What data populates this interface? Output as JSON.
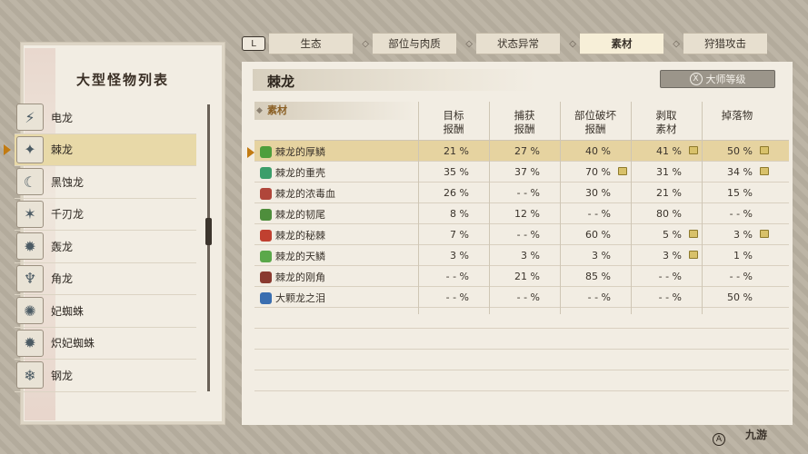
{
  "left": {
    "title": "大型怪物列表",
    "monsters": [
      {
        "name": "电龙",
        "icon": "zinogre-icon"
      },
      {
        "name": "棘龙",
        "icon": "espinas-icon",
        "selected": true
      },
      {
        "name": "黑蚀龙",
        "icon": "gore-magala-icon"
      },
      {
        "name": "千刃龙",
        "icon": "seregios-icon"
      },
      {
        "name": "轰龙",
        "icon": "tigrex-icon"
      },
      {
        "name": "角龙",
        "icon": "diablos-icon"
      },
      {
        "name": "妃蜘蛛",
        "icon": "rakna-kadaki-icon"
      },
      {
        "name": "炽妃蜘蛛",
        "icon": "pyre-rakna-kadaki-icon"
      },
      {
        "name": "钢龙",
        "icon": "kushala-daora-icon"
      }
    ]
  },
  "tabs": {
    "left_key": "L",
    "items": [
      "生态",
      "部位与肉质",
      "状态异常",
      "素材",
      "狩猎攻击"
    ],
    "active": "素材"
  },
  "header": {
    "monster_name": "棘龙",
    "master_rank_button": "大师等级",
    "x_key": "X"
  },
  "table": {
    "material_header": "素材",
    "columns": [
      "目标\n报酬",
      "捕获\n报酬",
      "部位破坏\n报酬",
      "剥取\n素材",
      "掉落物"
    ],
    "rows": [
      {
        "name": "棘龙的厚鳞",
        "color": "#4e9e3c",
        "values": [
          "21 %",
          "27 %",
          "40 %",
          "41 %",
          "50 %"
        ],
        "icons": [
          false,
          false,
          false,
          true,
          true
        ],
        "selected": true
      },
      {
        "name": "棘龙的重壳",
        "color": "#3c9e6a",
        "values": [
          "35 %",
          "37 %",
          "70 %",
          "31 %",
          "34 %"
        ],
        "icons": [
          false,
          false,
          true,
          false,
          true
        ]
      },
      {
        "name": "棘龙的浓毒血",
        "color": "#b0463a",
        "values": [
          "26 %",
          "- - %",
          "30 %",
          "21 %",
          "15 %"
        ],
        "icons": [
          false,
          false,
          false,
          false,
          false
        ]
      },
      {
        "name": "棘龙的韧尾",
        "color": "#4e8e3c",
        "values": [
          "8 %",
          "12 %",
          "- - %",
          "80 %",
          "- - %"
        ],
        "icons": [
          false,
          false,
          false,
          false,
          false
        ]
      },
      {
        "name": "棘龙的秘棘",
        "color": "#c04030",
        "values": [
          "7 %",
          "- - %",
          "60 %",
          "5 %",
          "3 %"
        ],
        "icons": [
          false,
          false,
          false,
          true,
          true
        ]
      },
      {
        "name": "棘龙的天鳞",
        "color": "#5aa84a",
        "values": [
          "3 %",
          "3 %",
          "3 %",
          "3 %",
          "1 %"
        ],
        "icons": [
          false,
          false,
          false,
          true,
          false
        ]
      },
      {
        "name": "棘龙的刚角",
        "color": "#8a3a30",
        "values": [
          "- - %",
          "21 %",
          "85 %",
          "- - %",
          "- - %"
        ],
        "icons": [
          false,
          false,
          false,
          false,
          false
        ]
      },
      {
        "name": "大颗龙之泪",
        "color": "#3a6eb0",
        "values": [
          "- - %",
          "- - %",
          "- - %",
          "- - %",
          "50 %"
        ],
        "icons": [
          false,
          false,
          false,
          false,
          false
        ]
      }
    ]
  },
  "footer": {
    "a_key": "A",
    "watermark": "九游"
  }
}
